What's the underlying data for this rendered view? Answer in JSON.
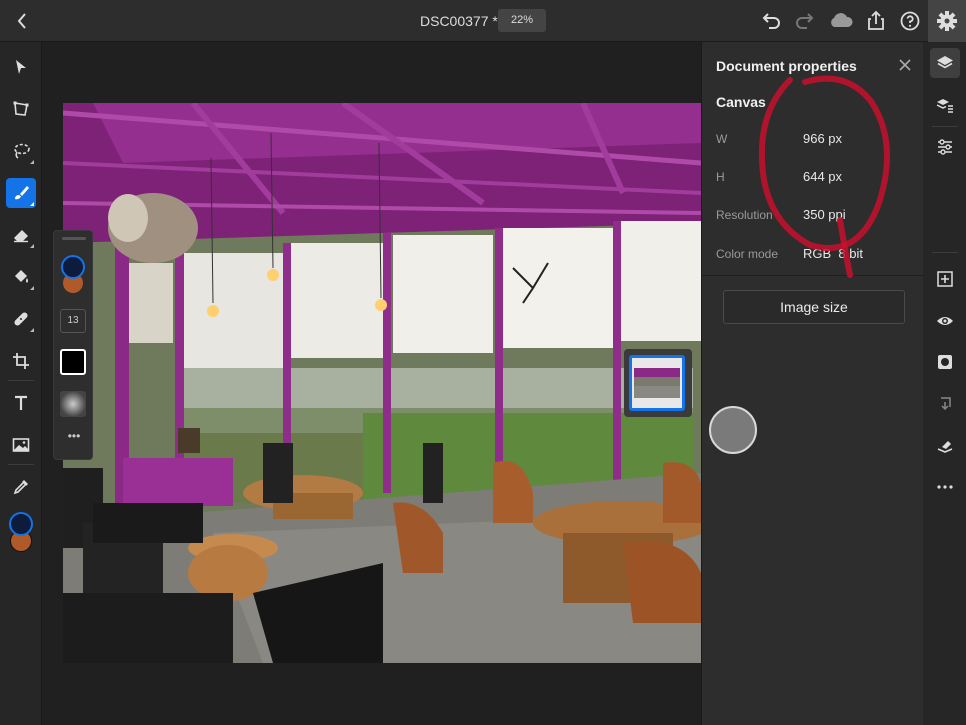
{
  "topbar": {
    "doc_title": "DSC00377 *",
    "zoom_label": "22%"
  },
  "document_properties": {
    "title": "Document properties",
    "section": "Canvas",
    "width_label": "W",
    "width_value": "966 px",
    "height_label": "H",
    "height_value": "644 px",
    "resolution_label": "Resolution",
    "resolution_value": "350 ppi",
    "color_mode_label": "Color mode",
    "color_mode_value": "RGB  8 bit",
    "image_size_button": "Image size"
  },
  "brush_panel": {
    "size_value": "13"
  },
  "colors": {
    "accent": "#1473e6",
    "foreground_swatch": "#0d1b3d",
    "background_swatch": "#b05a2a",
    "annotation": "#c8102e",
    "canopy": "#8a2a86"
  },
  "left_tools": [
    "select-tool",
    "transform-tool",
    "lasso-tool",
    "brush-tool",
    "eraser-tool",
    "fill-tool",
    "healing-tool",
    "crop-tool",
    "text-tool",
    "image-tool",
    "eyedropper-tool"
  ],
  "right_strip": [
    "layers-icon",
    "layer-properties-icon",
    "adjustments-icon",
    "add-layer-icon",
    "visibility-icon",
    "mask-icon",
    "merge-down-icon",
    "eraser-layer-icon",
    "more-icon"
  ]
}
